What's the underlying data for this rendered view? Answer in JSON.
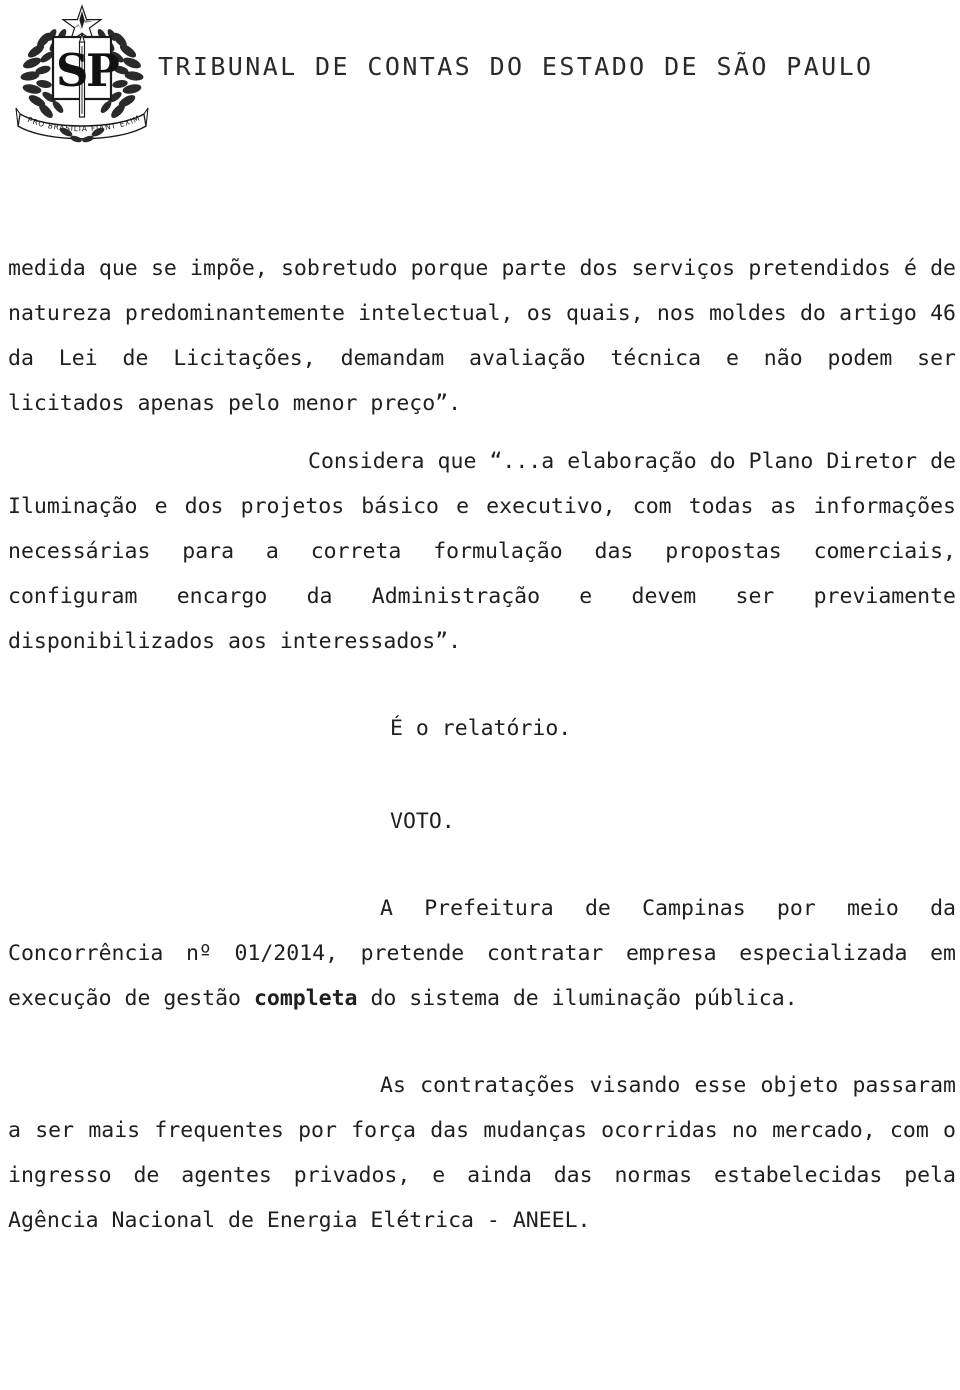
{
  "document": {
    "header": {
      "institution": "TRIBUNAL DE CONTAS DO ESTADO DE SÃO PAULO",
      "crest": {
        "shield_left_letter": "S",
        "shield_right_letter": "P",
        "motto_banner": "PRO BRASILIA FIANT EXIMIA"
      }
    },
    "body": {
      "paragraph_1": "medida que se impõe, sobretudo porque parte dos serviços pretendidos é de natureza predominantemente intelectual, os quais, nos moldes do artigo 46 da Lei de Licitações, demandam avaliação técnica e não podem ser licitados apenas pelo menor preço”.",
      "paragraph_2": "Considera que “...a elaboração do Plano Diretor de Iluminação e dos projetos básico e executivo, com todas as informações necessárias para a correta formulação das propostas comerciais, configuram encargo da Administração e devem ser previamente disponibilizados aos interessados”.",
      "report_close": "É o relatório.",
      "vote_heading": "VOTO.",
      "paragraph_3_part_a": "A Prefeitura de Campinas por meio da Concorrência nº 01/2014, pretende contratar empresa especializada em execução de gestão ",
      "paragraph_3_emphasis": "completa",
      "paragraph_3_part_b": " do sistema de iluminação pública.",
      "paragraph_4": "As contratações visando esse objeto passaram a ser mais frequentes por força das mudanças ocorridas no mercado, com o ingresso de agentes privados, e ainda das normas estabelecidas pela Agência Nacional de Energia Elétrica - ANEEL."
    },
    "colors": {
      "page_background": "#ffffff",
      "text": "#1f1f1f",
      "header_text": "#2a2a2a"
    }
  }
}
